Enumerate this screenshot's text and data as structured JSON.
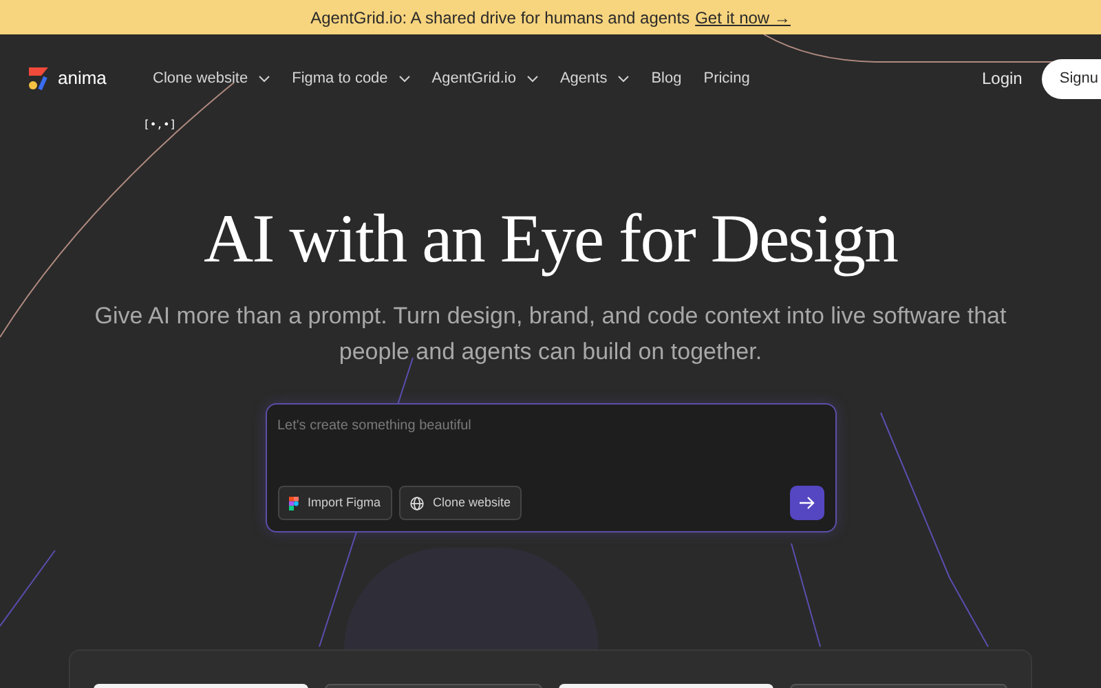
{
  "banner": {
    "text": "AgentGrid.io: A shared drive for humans and agents",
    "link": "Get it now →"
  },
  "nav": {
    "logo": "anima",
    "items": [
      {
        "label": "Clone website",
        "dropdown": true
      },
      {
        "label": "Figma to code",
        "dropdown": true
      },
      {
        "label": "AgentGrid.io",
        "dropdown": true
      },
      {
        "label": "Agents",
        "dropdown": true
      },
      {
        "label": "Blog",
        "dropdown": false
      },
      {
        "label": "Pricing",
        "dropdown": false
      }
    ],
    "login": "Login",
    "signup": "Signu"
  },
  "mascot": "[•,•]",
  "hero": {
    "title": "AI with an Eye for Design",
    "subtitle": "Give AI more than a prompt. Turn design, brand, and code context into live software that people and agents can build on together."
  },
  "prompt": {
    "placeholder": "Let's create something beautiful",
    "buttons": [
      {
        "label": "Import Figma",
        "kind": "figma"
      },
      {
        "label": "Clone website",
        "kind": "globe"
      }
    ]
  }
}
